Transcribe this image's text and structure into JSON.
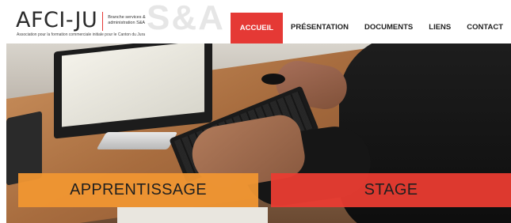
{
  "brand": {
    "logo_text": "AFCI-JU",
    "logo_sub": "Branche services & administration S&A",
    "tagline": "Association pour la formation commerciale initiale pour le Canton du Jura",
    "watermark": "S&A",
    "accent_color": "#e53935"
  },
  "nav": {
    "items": [
      {
        "label": "ACCUEIL",
        "active": true
      },
      {
        "label": "PRÉSENTATION",
        "active": false
      },
      {
        "label": "DOCUMENTS",
        "active": false
      },
      {
        "label": "LIENS",
        "active": false
      },
      {
        "label": "CONTACT",
        "active": false
      }
    ]
  },
  "hero": {
    "buttons": [
      {
        "label": "APPRENTISSAGE",
        "color": "#f0962f"
      },
      {
        "label": "STAGE",
        "color": "#e93c32"
      }
    ]
  }
}
